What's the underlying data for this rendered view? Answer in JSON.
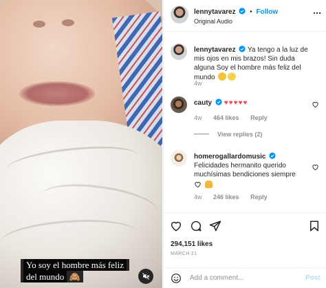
{
  "post": {
    "username": "lennytavarez",
    "follow_label": "Follow",
    "audio": "Original Audio",
    "separator": "•",
    "caption_text": "Ya tengo a la luz de mis ojos en mis brazos! Sin duda alguna Soy el hombre más feliz del mundo",
    "caption_time": "4w"
  },
  "video": {
    "overlay_caption": "Yo soy el hombre más feliz del mundo",
    "icons": {
      "mute": "speaker-muted-icon"
    }
  },
  "comments": [
    {
      "username": "cauty",
      "text": "♥♥♥♥♥",
      "time": "4w",
      "likes": "464 likes",
      "reply_label": "Reply",
      "view_replies": "View replies (2)"
    },
    {
      "username": "homerogallardomusic",
      "text": "Felicidades hermanito querido muchísimas bendiciones siempre",
      "time": "4w",
      "likes": "246 likes",
      "reply_label": "Reply"
    }
  ],
  "actions": {
    "likes_count": "294,151 likes",
    "date": "MARCH 21",
    "icons": [
      "heart-icon",
      "comment-icon",
      "share-icon",
      "bookmark-icon"
    ]
  },
  "composer": {
    "placeholder": "Add a comment...",
    "post_label": "Post"
  },
  "colors": {
    "link_blue": "#0095f6",
    "muted_text": "#8e8e8e",
    "heart_red": "#ed4956",
    "post_disabled": "#b3dbff"
  }
}
